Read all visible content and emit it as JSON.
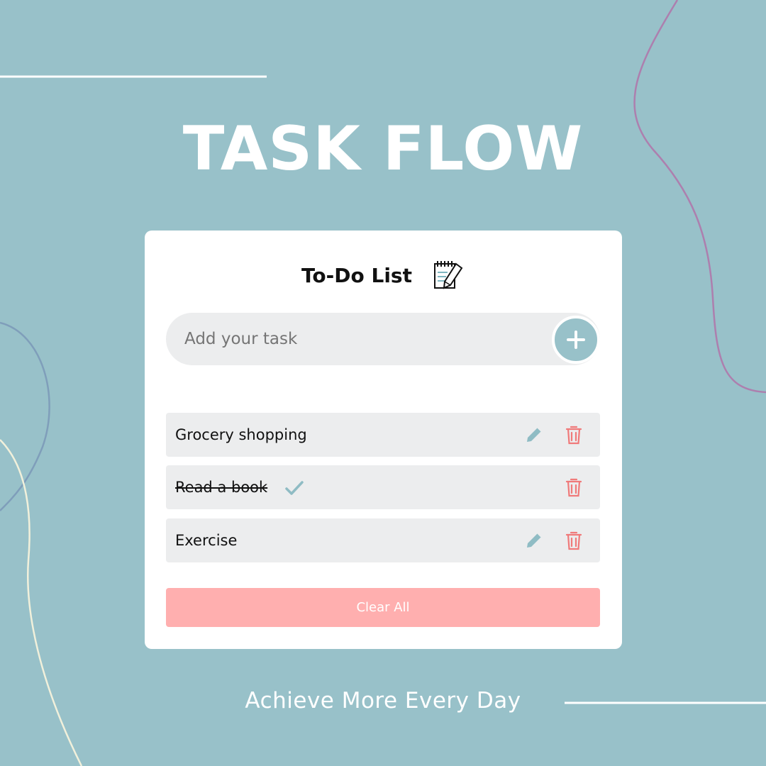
{
  "app": {
    "title": "TASK FLOW",
    "tagline": "Achieve More Every Day"
  },
  "card": {
    "title": "To-Do List"
  },
  "input": {
    "placeholder": "Add your task",
    "value": ""
  },
  "tasks": [
    {
      "text": "Grocery shopping",
      "completed": false
    },
    {
      "text": "Read a book",
      "completed": true
    },
    {
      "text": "Exercise",
      "completed": false
    }
  ],
  "actions": {
    "clear_label": "Clear All"
  },
  "icons": {
    "add": "plus-icon",
    "notepad": "notepad-pencil-icon",
    "edit": "pencil-icon",
    "delete": "trash-icon",
    "done": "check-icon"
  },
  "colors": {
    "background": "#98c1c9",
    "card": "#ffffff",
    "input_bg": "#ecedee",
    "accent": "#98c1c9",
    "danger": "#f07a7a",
    "clear_button": "#ffafaf"
  }
}
